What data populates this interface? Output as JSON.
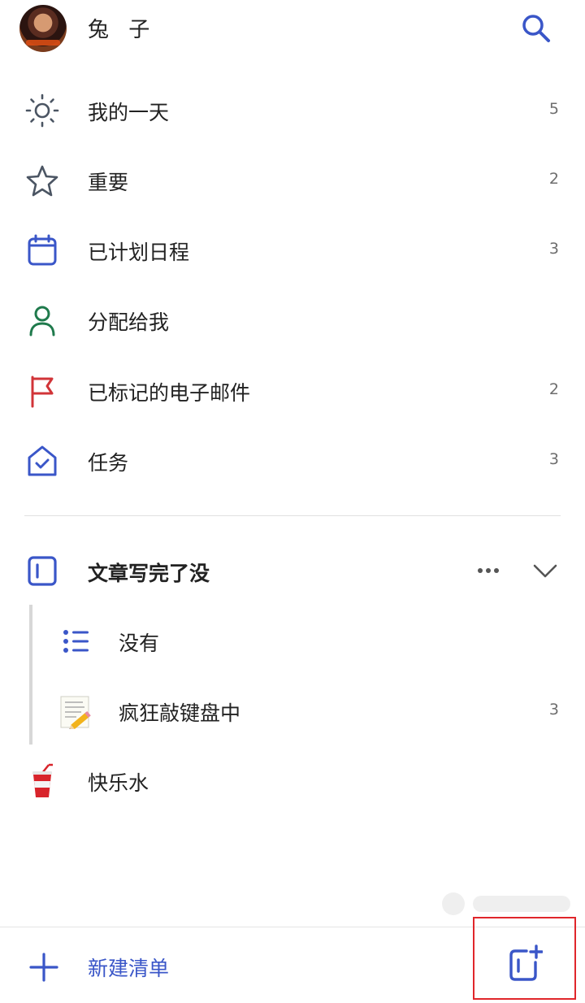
{
  "user": {
    "name": "兔 子"
  },
  "smart_lists": [
    {
      "icon": "sun-icon",
      "label": "我的一天",
      "count": "5",
      "color": "#4b5563"
    },
    {
      "icon": "star-icon",
      "label": "重要",
      "count": "2",
      "color": "#4b5563"
    },
    {
      "icon": "calendar-icon",
      "label": "已计划日程",
      "count": "3",
      "color": "#3a56c8"
    },
    {
      "icon": "person-icon",
      "label": "分配给我",
      "count": "",
      "color": "#1f7a4c"
    },
    {
      "icon": "flag-icon",
      "label": "已标记的电子邮件",
      "count": "2",
      "color": "#d13438"
    },
    {
      "icon": "home-check-icon",
      "label": "任务",
      "count": "3",
      "color": "#3a56c8"
    }
  ],
  "group": {
    "icon": "group-icon",
    "label": "文章写完了没",
    "lists": [
      {
        "icon": "list-icon",
        "label": "没有",
        "count": ""
      },
      {
        "icon": "memo-emoji-icon",
        "label": "疯狂敲键盘中",
        "count": "3"
      }
    ]
  },
  "standalone_list": {
    "icon": "drink-cup-emoji-icon",
    "label": "快乐水",
    "count": ""
  },
  "footer": {
    "new_list_label": "新建清单"
  },
  "colors": {
    "accent": "#3a56c8",
    "highlight_border": "#e0262b"
  }
}
